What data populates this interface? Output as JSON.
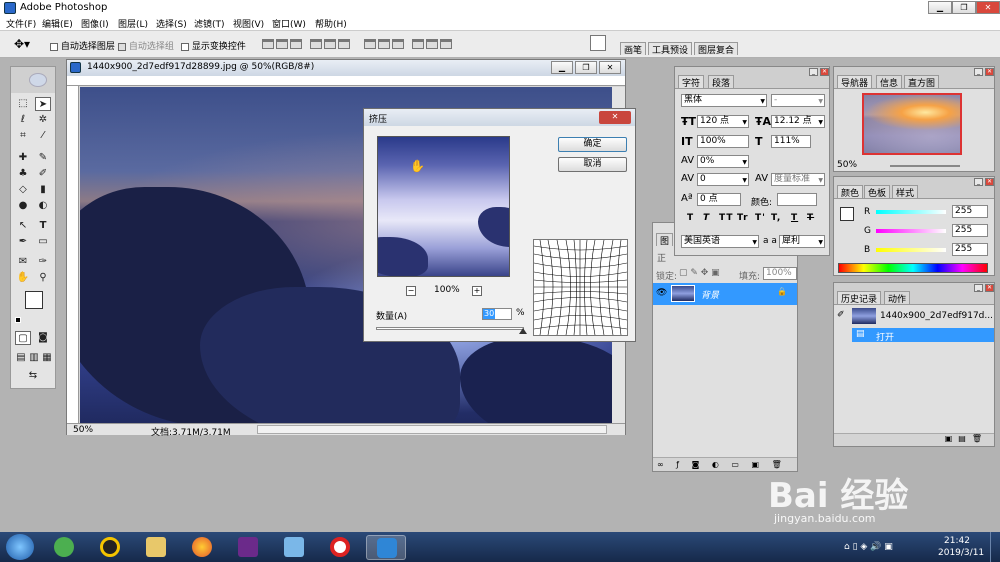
{
  "app": {
    "title": "Adobe Photoshop"
  },
  "menu": [
    "文件(F)",
    "编辑(E)",
    "图像(I)",
    "图层(L)",
    "选择(S)",
    "滤镜(T)",
    "视图(V)",
    "窗口(W)",
    "帮助(H)"
  ],
  "options": {
    "auto_select_layer": "自动选择图层",
    "auto_select_group": "自动选择组",
    "show_transform": "显示变换控件"
  },
  "well_tabs": [
    "画笔",
    "工具预设",
    "图层复合"
  ],
  "document": {
    "title": "1440x900_2d7edf917d28899.jpg @ 50%(RGB/8#)",
    "zoom": "50%",
    "doc_size": "文档:3.71M/3.71M"
  },
  "dialog": {
    "title": "挤压",
    "ok": "确定",
    "cancel": "取消",
    "zoom": "100%",
    "amount_label": "数量(A)",
    "amount_value": "30",
    "amount_unit": "%",
    "zoom_out": "−",
    "zoom_in": "+"
  },
  "character_panel": {
    "tabs": [
      "字符",
      "段落"
    ],
    "font_family": "黑体",
    "font_style": "-",
    "font_size": "120 点",
    "leading": "12.12 点",
    "vscale": "100%",
    "hscale": "111%",
    "tracking": "0%",
    "kerning": "0",
    "kerning_mode": "度量标准",
    "baseline": "0 点",
    "color_label": "颜色:",
    "language": "美国英语",
    "aa_label": "a a",
    "antialias": "犀利",
    "style_buttons": [
      "T",
      "T",
      "TT",
      "Tr",
      "T'",
      "T,",
      "T",
      "T"
    ]
  },
  "layers_panel": {
    "tab": "图",
    "mode": "正",
    "lock_label": "锁定:",
    "fill_label": "填充:",
    "fill_value": "100%",
    "layer_name": "背景"
  },
  "navigator_panel": {
    "tabs": [
      "导航器",
      "信息",
      "直方图"
    ],
    "zoom": "50%"
  },
  "color_panel": {
    "tabs": [
      "颜色",
      "色板",
      "样式"
    ],
    "R": "255",
    "G": "255",
    "B": "255",
    "R_label": "R",
    "G_label": "G",
    "B_label": "B"
  },
  "history_panel": {
    "tabs": [
      "历史记录",
      "动作"
    ],
    "snapshot": "1440x900_2d7edf917d...",
    "step": "打开"
  },
  "taskbar": {
    "time": "21:42",
    "date": "2019/3/11"
  },
  "watermark": {
    "brand": "Bai 经验",
    "url": "jingyan.baidu.com"
  },
  "colors": {
    "accent": "#3399ff",
    "selected": "#3399ff",
    "title_gradient": "#cdd7e4"
  }
}
